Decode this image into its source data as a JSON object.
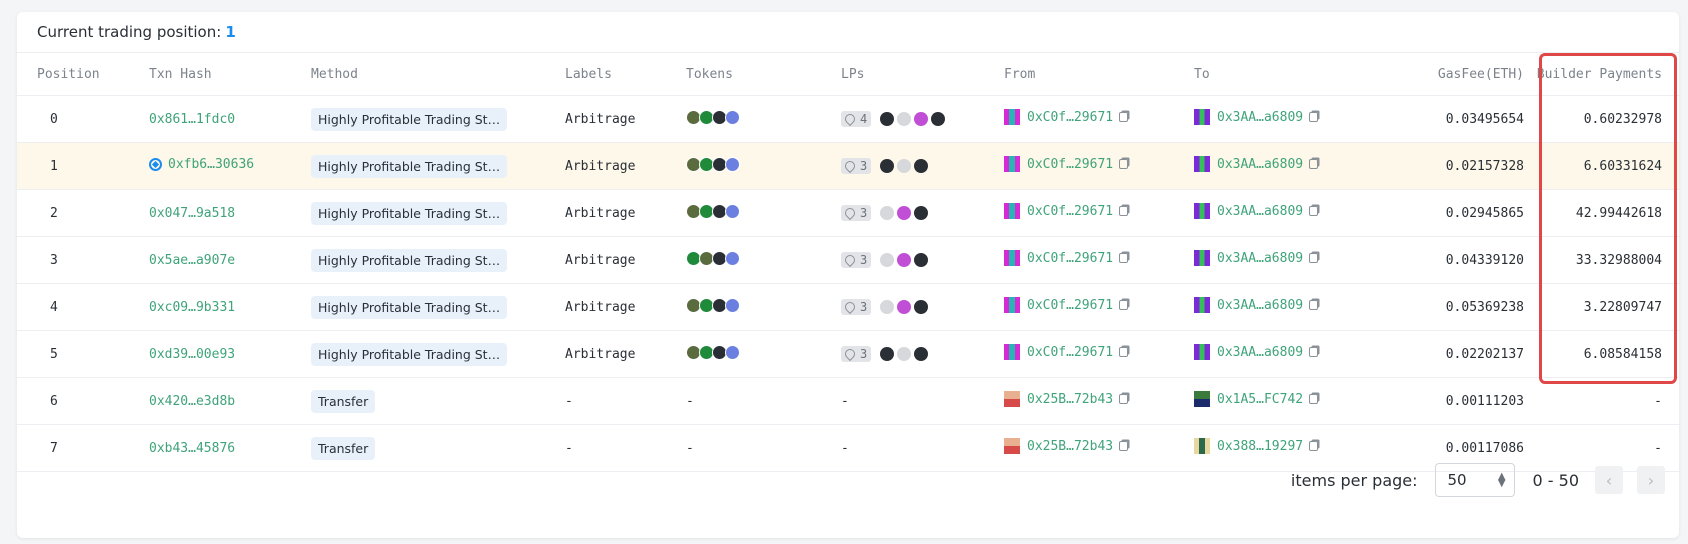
{
  "header": {
    "label": "Current trading position:",
    "position": "1"
  },
  "columns": [
    "Position",
    "Txn Hash",
    "Method",
    "Labels",
    "Tokens",
    "LPs",
    "From",
    "To",
    "GasFee(ETH)",
    "Builder Payments"
  ],
  "rows": [
    {
      "position": "0",
      "hash": "0x861…1fdc0",
      "method": "Highly Profitable Trading St…",
      "label": "Arbitrage",
      "lps": "4",
      "from": "0xC0f…29671",
      "to": "0x3AA…a6809",
      "gas": "0.03495654",
      "builder": "0.60232978"
    },
    {
      "position": "1",
      "hash": "0xfb6…30636",
      "method": "Highly Profitable Trading St…",
      "label": "Arbitrage",
      "lps": "3",
      "from": "0xC0f…29671",
      "to": "0x3AA…a6809",
      "gas": "0.02157328",
      "builder": "6.60331624"
    },
    {
      "position": "2",
      "hash": "0x047…9a518",
      "method": "Highly Profitable Trading St…",
      "label": "Arbitrage",
      "lps": "3",
      "from": "0xC0f…29671",
      "to": "0x3AA…a6809",
      "gas": "0.02945865",
      "builder": "42.99442618"
    },
    {
      "position": "3",
      "hash": "0x5ae…a907e",
      "method": "Highly Profitable Trading St…",
      "label": "Arbitrage",
      "lps": "3",
      "from": "0xC0f…29671",
      "to": "0x3AA…a6809",
      "gas": "0.04339120",
      "builder": "33.32988004"
    },
    {
      "position": "4",
      "hash": "0xc09…9b331",
      "method": "Highly Profitable Trading St…",
      "label": "Arbitrage",
      "lps": "3",
      "from": "0xC0f…29671",
      "to": "0x3AA…a6809",
      "gas": "0.05369238",
      "builder": "3.22809747"
    },
    {
      "position": "5",
      "hash": "0xd39…00e93",
      "method": "Highly Profitable Trading St…",
      "label": "Arbitrage",
      "lps": "3",
      "from": "0xC0f…29671",
      "to": "0x3AA…a6809",
      "gas": "0.02202137",
      "builder": "6.08584158"
    },
    {
      "position": "6",
      "hash": "0x420…e3d8b",
      "method": "Transfer",
      "label": "-",
      "tokens": "-",
      "lps_text": "-",
      "from": "0x25B…72b43",
      "to": "0x1A5…FC742",
      "gas": "0.00111203",
      "builder": "-"
    },
    {
      "position": "7",
      "hash": "0xb43…45876",
      "method": "Transfer",
      "label": "-",
      "tokens": "-",
      "lps_text": "-",
      "from": "0x25B…72b43",
      "to": "0x388…19297",
      "gas": "0.00117086",
      "builder": "-"
    }
  ],
  "footer": {
    "items_label": "items per page:",
    "per_page": "50",
    "range": "0 - 50",
    "prev": "‹",
    "next": "›"
  }
}
